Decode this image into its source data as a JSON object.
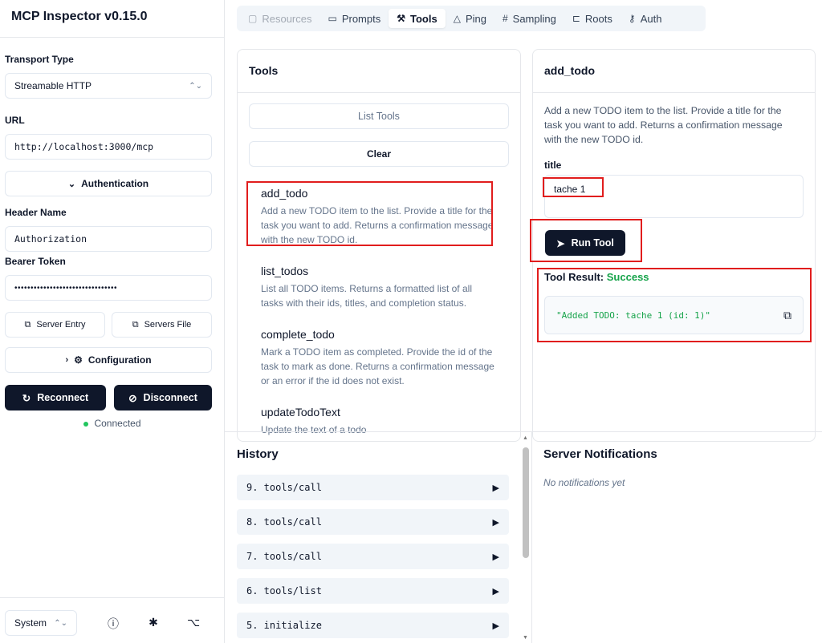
{
  "app": {
    "title": "MCP Inspector v0.15.0"
  },
  "sidebar": {
    "transport_label": "Transport Type",
    "transport_value": "Streamable HTTP",
    "url_label": "URL",
    "url_value": "http://localhost:3000/mcp",
    "auth_label": "Authentication",
    "header_name_label": "Header Name",
    "header_name_value": "Authorization",
    "bearer_label": "Bearer Token",
    "bearer_value": "••••••••••••••••••••••••••••••••",
    "server_entry_label": "Server Entry",
    "servers_file_label": "Servers File",
    "configuration_label": "Configuration",
    "reconnect_label": "Reconnect",
    "disconnect_label": "Disconnect",
    "status_text": "Connected",
    "status_color": "#22c55e",
    "theme_value": "System"
  },
  "tabs": [
    {
      "label": "Resources",
      "icon": "resources-icon",
      "state": "disabled"
    },
    {
      "label": "Prompts",
      "icon": "prompts-icon",
      "state": "normal"
    },
    {
      "label": "Tools",
      "icon": "tools-icon",
      "state": "active"
    },
    {
      "label": "Ping",
      "icon": "bell-icon",
      "state": "normal"
    },
    {
      "label": "Sampling",
      "icon": "hash-icon",
      "state": "normal"
    },
    {
      "label": "Roots",
      "icon": "roots-icon",
      "state": "normal"
    },
    {
      "label": "Auth",
      "icon": "key-icon",
      "state": "normal"
    }
  ],
  "tools_panel": {
    "title": "Tools",
    "list_tools_label": "List Tools",
    "clear_label": "Clear",
    "items": [
      {
        "name": "add_todo",
        "description": "Add a new TODO item to the list. Provide a title for the task you want to add. Returns a confirmation message with the new TODO id."
      },
      {
        "name": "list_todos",
        "description": "List all TODO items. Returns a formatted list of all tasks with their ids, titles, and completion status."
      },
      {
        "name": "complete_todo",
        "description": "Mark a TODO item as completed. Provide the id of the task to mark as done. Returns a confirmation message or an error if the id does not exist."
      },
      {
        "name": "updateTodoText",
        "description": "Update the text of a todo"
      }
    ]
  },
  "tool_detail": {
    "title": "add_todo",
    "description": "Add a new TODO item to the list. Provide a title for the task you want to add. Returns a confirmation message with the new TODO id.",
    "param_label": "title",
    "param_value": "tache 1",
    "run_label": "Run Tool",
    "result_label": "Tool Result:",
    "result_status": "Success",
    "result_text": "\"Added TODO: tache 1 (id: 1)\"",
    "success_color": "#16a34a"
  },
  "history": {
    "title": "History",
    "items": [
      "9. tools/call",
      "8. tools/call",
      "7. tools/call",
      "6. tools/list",
      "5. initialize"
    ]
  },
  "notifications": {
    "title": "Server Notifications",
    "empty_text": "No notifications yet"
  },
  "annotation_color": "#e11d1d"
}
